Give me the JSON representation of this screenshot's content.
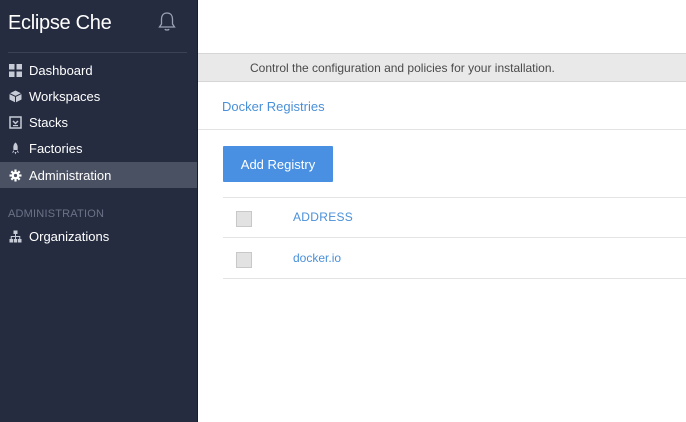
{
  "sidebar": {
    "brand": "Eclipse Che",
    "nav": [
      {
        "label": "Dashboard",
        "icon": "dashboard-icon"
      },
      {
        "label": "Workspaces",
        "icon": "workspaces-icon"
      },
      {
        "label": "Stacks",
        "icon": "stacks-icon"
      },
      {
        "label": "Factories",
        "icon": "factories-icon"
      },
      {
        "label": "Administration",
        "icon": "gear-icon",
        "active": true
      }
    ],
    "section_label": "ADMINISTRATION",
    "section_items": [
      {
        "label": "Organizations",
        "icon": "organizations-icon"
      }
    ]
  },
  "main": {
    "info_text": "Control the configuration and policies for your installation.",
    "breadcrumb": "Docker Registries",
    "add_button": "Add Registry",
    "table": {
      "header": "ADDRESS",
      "rows": [
        "docker.io"
      ]
    }
  },
  "colors": {
    "sidebar_bg": "#252c40",
    "active_item_bg": "#4a5163",
    "accent": "#4a90e2",
    "link": "#4a90d9"
  }
}
